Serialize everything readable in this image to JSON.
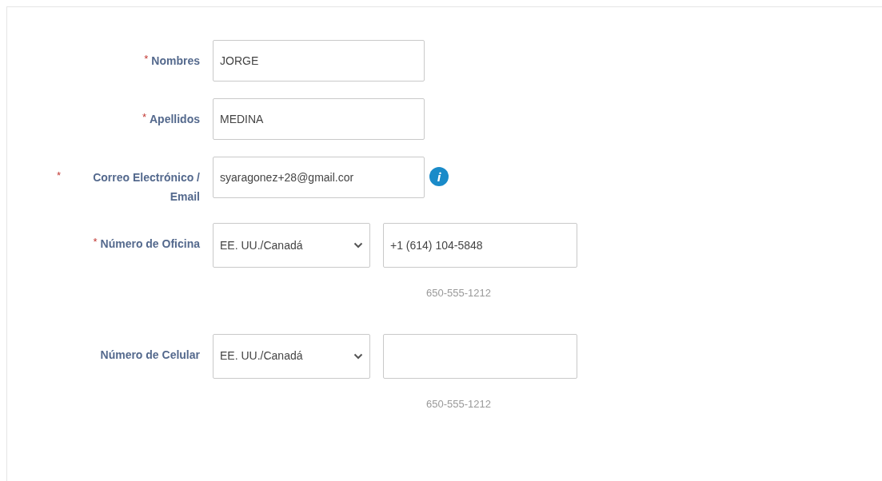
{
  "fields": [
    {
      "kind": "text",
      "label": "Nombres",
      "required_mark": "*",
      "value": "JORGE"
    },
    {
      "kind": "text",
      "label": "Apellidos",
      "required_mark": "*",
      "value": "MEDINA"
    },
    {
      "kind": "email",
      "label": "Correo Electrónico / Email",
      "required_mark": "*",
      "value": "syaragonez+28@gmail.cor"
    },
    {
      "kind": "phone",
      "label": "Número de Oficina",
      "required_mark": "*",
      "country": "EE. UU./Canadá",
      "value": "+1 (614) 104-5848",
      "hint": "650-555-1212"
    },
    {
      "kind": "phone",
      "label": "Número de Celular",
      "country": "EE. UU./Canadá",
      "hint": "650-555-1212"
    }
  ]
}
